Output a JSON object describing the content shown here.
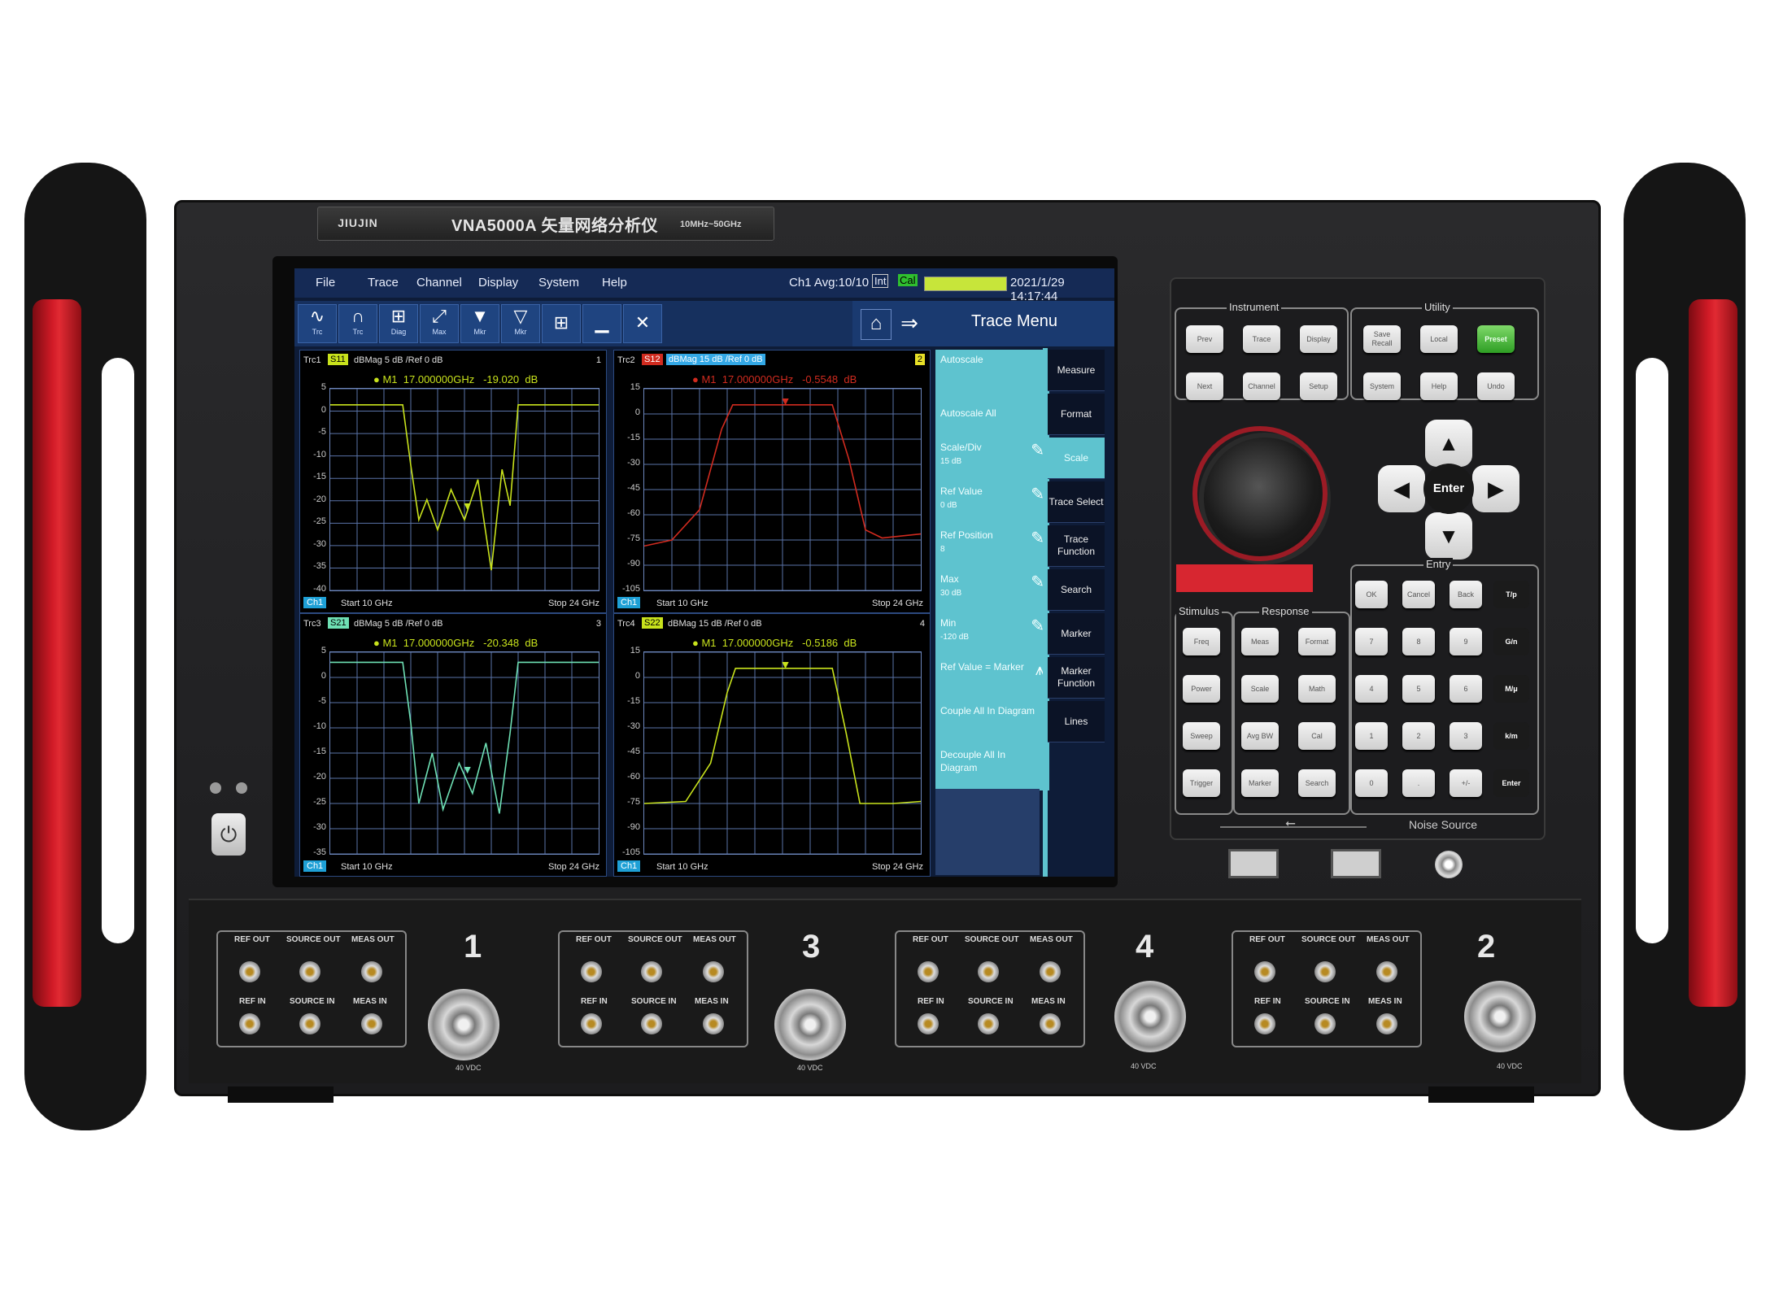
{
  "brand": {
    "logo": "JIUJIN",
    "model": "VNA5000A 矢量网络分析仪",
    "range": "10MHz~50GHz"
  },
  "menubar": {
    "items": [
      "File",
      "Trace",
      "Channel",
      "Display",
      "System",
      "Help"
    ],
    "status": "Ch1 Avg:10/10",
    "int_badge": "Int",
    "cal_badge": "Cal",
    "datetime": "2021/1/29 14:17:44"
  },
  "toolbar": {
    "buttons": [
      {
        "label": "Trc",
        "icon": "trace-add-icon"
      },
      {
        "label": "Trc",
        "icon": "trace-remove-icon"
      },
      {
        "label": "Diag",
        "icon": "diagram-icon"
      },
      {
        "label": "Max",
        "icon": "maximize-icon"
      },
      {
        "label": "Mkr",
        "icon": "marker-add-icon"
      },
      {
        "label": "Mkr",
        "icon": "marker-remove-icon"
      },
      {
        "label": "",
        "icon": "windows-icon"
      },
      {
        "label": "",
        "icon": "minimize-icon"
      },
      {
        "label": "",
        "icon": "close-icon"
      }
    ],
    "menu_title": "Trace Menu"
  },
  "diagrams": [
    {
      "trace": "Trc1",
      "param": "S11",
      "format": "dBMag 5 dB /Ref 0 dB",
      "num": "1",
      "marker": "M1",
      "freq": "17.000000GHz",
      "value": "-19.020",
      "unit": "dB",
      "ch": "Ch1",
      "start": "Start 10 GHz",
      "stop": "Stop 24 GHz",
      "yticks": [
        "5",
        "0",
        "-5",
        "-10",
        "-15",
        "-20",
        "-25",
        "-30",
        "-35",
        "-40"
      ],
      "color": "#c8e21c"
    },
    {
      "trace": "Trc2",
      "param": "S12",
      "format": "dBMag 15 dB /Ref 0 dB",
      "num": "2",
      "marker": "M1",
      "freq": "17.000000GHz",
      "value": "-0.5548",
      "unit": "dB",
      "ch": "Ch1",
      "start": "Start 10 GHz",
      "stop": "Stop 24 GHz",
      "yticks": [
        "15",
        "0",
        "-15",
        "-30",
        "-45",
        "-60",
        "-75",
        "-90",
        "-105"
      ],
      "color": "#d12b1f"
    },
    {
      "trace": "Trc3",
      "param": "S21",
      "format": "dBMag 5 dB /Ref 0 dB",
      "num": "3",
      "marker": "M1",
      "freq": "17.000000GHz",
      "value": "-20.348",
      "unit": "dB",
      "ch": "Ch1",
      "start": "Start 10 GHz",
      "stop": "Stop 24 GHz",
      "yticks": [
        "5",
        "0",
        "-5",
        "-10",
        "-15",
        "-20",
        "-25",
        "-30",
        "-35"
      ],
      "color": "#6ee0b4"
    },
    {
      "trace": "Trc4",
      "param": "S22",
      "format": "dBMag 15 dB /Ref 0 dB",
      "num": "4",
      "marker": "M1",
      "freq": "17.000000GHz",
      "value": "-0.5186",
      "unit": "dB",
      "ch": "Ch1",
      "start": "Start 10 GHz",
      "stop": "Stop 24 GHz",
      "yticks": [
        "15",
        "0",
        "-15",
        "-30",
        "-45",
        "-60",
        "-75",
        "-90",
        "-105"
      ],
      "color": "#c8e21c"
    }
  ],
  "softkeys": [
    {
      "label": "Autoscale",
      "sub": ""
    },
    {
      "label": "Autoscale All",
      "sub": ""
    },
    {
      "label": "Scale/Div",
      "sub": "15 dB"
    },
    {
      "label": "Ref Value",
      "sub": "0 dB"
    },
    {
      "label": "Ref Position",
      "sub": "8"
    },
    {
      "label": "Max",
      "sub": "30 dB"
    },
    {
      "label": "Min",
      "sub": "-120 dB"
    },
    {
      "label": "Ref Value = Marker",
      "sub": ""
    },
    {
      "label": "Couple All In Diagram",
      "sub": ""
    },
    {
      "label": "Decouple All In Diagram",
      "sub": ""
    }
  ],
  "rightmenu": [
    "Measure",
    "Format",
    "Scale",
    "Trace Select",
    "Trace Function",
    "Search",
    "Marker",
    "Marker Function",
    "Lines"
  ],
  "keypad": {
    "instrument_label": "Instrument",
    "utility_label": "Utility",
    "instrument_keys": [
      "Prev",
      "Trace",
      "Display",
      "Next",
      "Channel",
      "Setup"
    ],
    "utility_keys": [
      "Save Recall",
      "Local",
      "Preset",
      "System",
      "Help",
      "Undo"
    ],
    "enter": "Enter",
    "entry_label": "Entry",
    "stimulus_label": "Stimulus",
    "response_label": "Response",
    "stimulus_keys": [
      "Freq",
      "Power",
      "Sweep",
      "Trigger"
    ],
    "response_keys": [
      "Meas",
      "Format",
      "Scale",
      "Math",
      "Avg BW",
      "Cal",
      "Marker",
      "Search"
    ],
    "entry_top": [
      "OK",
      "Cancel",
      "Back"
    ],
    "digits": [
      "7",
      "8",
      "9",
      "4",
      "5",
      "6",
      "1",
      "2",
      "3",
      "0",
      ".",
      "+/-"
    ],
    "units": [
      "T/p",
      "G/n",
      "M/μ",
      "k/m",
      "Enter"
    ],
    "noise_source": "Noise Source"
  },
  "ports": [
    {
      "num": "1",
      "rating": "40 VDC"
    },
    {
      "num": "3",
      "rating": "40 VDC"
    },
    {
      "num": "4",
      "rating": "40 VDC"
    },
    {
      "num": "2",
      "rating": "40 VDC"
    }
  ],
  "coupler": {
    "ref_out": "REF OUT",
    "source_out": "SOURCE OUT",
    "meas_out": "MEAS OUT",
    "ref_in": "REF IN",
    "source_in": "SOURCE IN",
    "meas_in": "MEAS IN"
  }
}
